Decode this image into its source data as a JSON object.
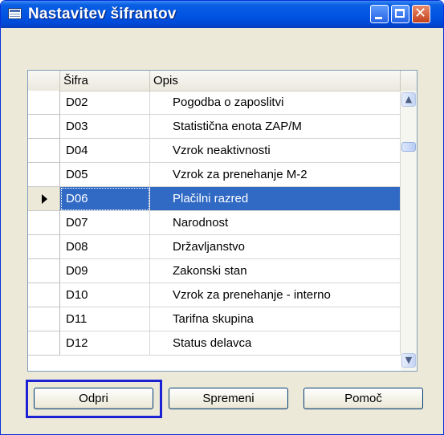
{
  "window": {
    "title": "Nastavitev šifrantov",
    "controls": {
      "minimize": "minimize",
      "maximize": "maximize",
      "close": "✕"
    }
  },
  "table": {
    "columns": [
      "Šifra",
      "Opis"
    ],
    "rows": [
      {
        "code": "D02",
        "description": "Pogodba o zaposlitvi",
        "selected": false
      },
      {
        "code": "D03",
        "description": "Statistična enota ZAP/M",
        "selected": false
      },
      {
        "code": "D04",
        "description": "Vzrok neaktivnosti",
        "selected": false
      },
      {
        "code": "D05",
        "description": "Vzrok za prenehanje M-2",
        "selected": false
      },
      {
        "code": "D06",
        "description": "Plačilni razred",
        "selected": true
      },
      {
        "code": "D07",
        "description": "Narodnost",
        "selected": false
      },
      {
        "code": "D08",
        "description": "Državljanstvo",
        "selected": false
      },
      {
        "code": "D09",
        "description": "Zakonski stan",
        "selected": false
      },
      {
        "code": "D10",
        "description": "Vzrok za prenehanje - interno",
        "selected": false
      },
      {
        "code": "D11",
        "description": "Tarifna skupina",
        "selected": false
      },
      {
        "code": "D12",
        "description": "Status delavca",
        "selected": false
      }
    ],
    "scrollbar": {
      "up": "▲",
      "down": "▼"
    }
  },
  "buttons": {
    "open": "Odpri",
    "edit": "Spremeni",
    "help": "Pomoč"
  },
  "colors": {
    "selection": "#316ac5",
    "focus_frame": "#1c22d4",
    "title_bar": "#0054e3"
  },
  "icons": {
    "title": "table-window-icon",
    "row_selector": "triangle-right-icon"
  }
}
